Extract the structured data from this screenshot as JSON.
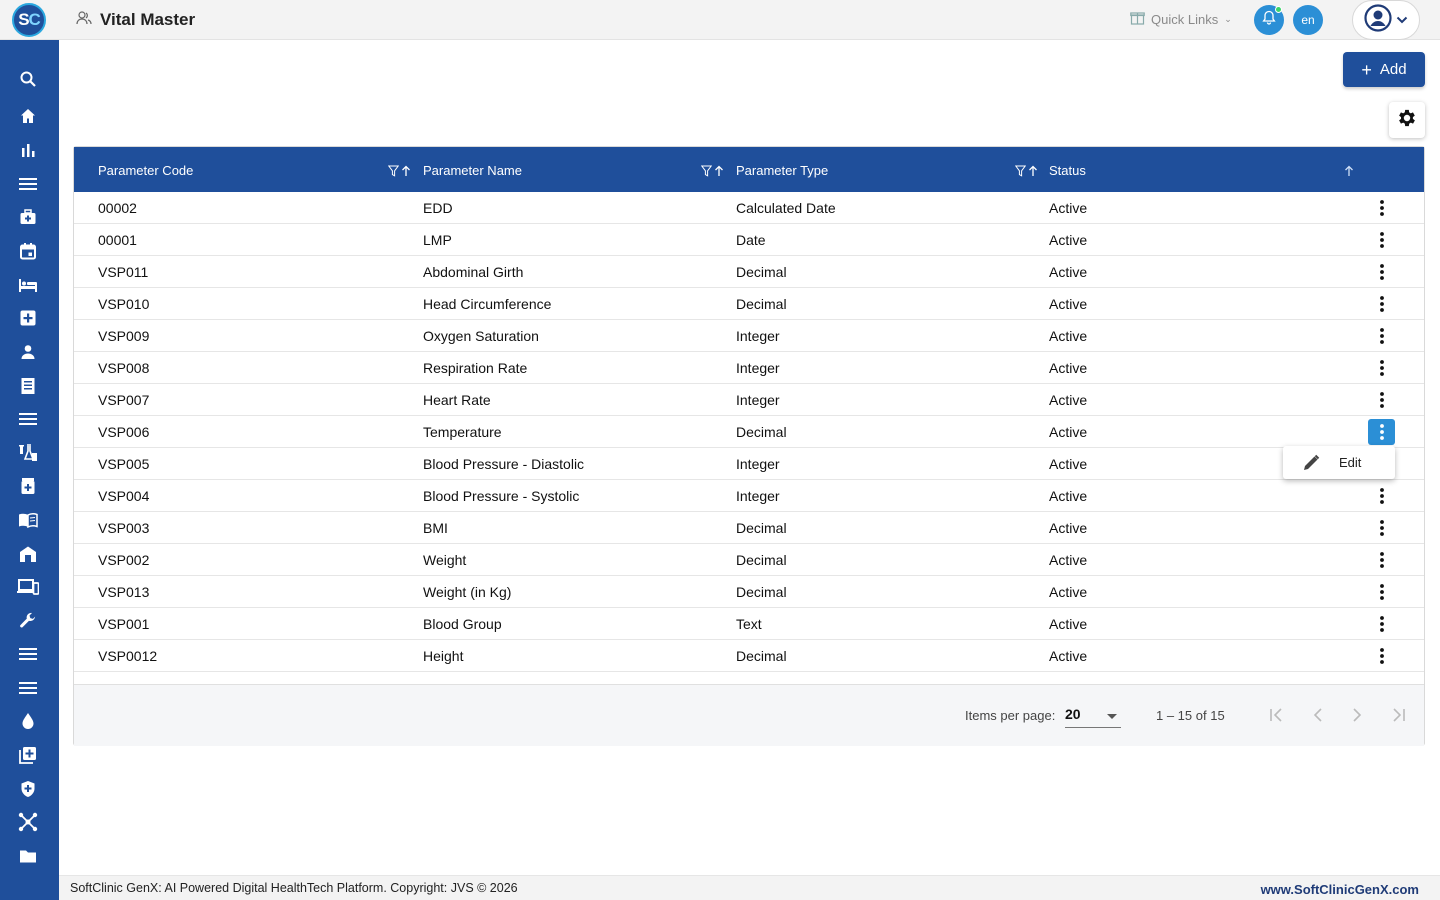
{
  "app": {
    "logo_text_1": "S",
    "logo_text_2": "C",
    "page_title": "Vital Master",
    "quick_links_label": "Quick Links",
    "language": "en"
  },
  "sidebar": {
    "items": [
      {
        "icon": "search-icon"
      },
      {
        "icon": "home-icon"
      },
      {
        "icon": "bar-chart-icon"
      },
      {
        "icon": "menu-lines-icon"
      },
      {
        "icon": "medical-bag-icon"
      },
      {
        "icon": "calendar-icon"
      },
      {
        "icon": "bed-icon"
      },
      {
        "icon": "hospital-plus-icon"
      },
      {
        "icon": "person-icon"
      },
      {
        "icon": "receipt-icon"
      },
      {
        "icon": "menu-lines-icon"
      },
      {
        "icon": "lab-flask-icon"
      },
      {
        "icon": "pharmacy-icon"
      },
      {
        "icon": "book-icon"
      },
      {
        "icon": "store-icon"
      },
      {
        "icon": "devices-icon"
      },
      {
        "icon": "wrench-icon"
      },
      {
        "icon": "menu-lines-icon"
      },
      {
        "icon": "menu-lines-icon"
      },
      {
        "icon": "blood-drop-icon"
      },
      {
        "icon": "add-box-icon"
      },
      {
        "icon": "shield-icon"
      },
      {
        "icon": "network-icon"
      },
      {
        "icon": "folder-icon"
      }
    ]
  },
  "toolbar": {
    "add_label": "Add"
  },
  "table": {
    "columns": [
      "Parameter Code",
      "Parameter Name",
      "Parameter Type",
      "Status"
    ],
    "rows": [
      {
        "code": "00002",
        "name": "EDD",
        "type": "Calculated Date",
        "status": "Active"
      },
      {
        "code": "00001",
        "name": "LMP",
        "type": "Date",
        "status": "Active"
      },
      {
        "code": "VSP011",
        "name": "Abdominal Girth",
        "type": "Decimal",
        "status": "Active"
      },
      {
        "code": "VSP010",
        "name": "Head Circumference",
        "type": "Decimal",
        "status": "Active"
      },
      {
        "code": "VSP009",
        "name": "Oxygen Saturation",
        "type": "Integer",
        "status": "Active"
      },
      {
        "code": "VSP008",
        "name": "Respiration Rate",
        "type": "Integer",
        "status": "Active"
      },
      {
        "code": "VSP007",
        "name": "Heart Rate",
        "type": "Integer",
        "status": "Active"
      },
      {
        "code": "VSP006",
        "name": "Temperature",
        "type": "Decimal",
        "status": "Active"
      },
      {
        "code": "VSP005",
        "name": "Blood Pressure - Diastolic",
        "type": "Integer",
        "status": "Active"
      },
      {
        "code": "VSP004",
        "name": "Blood Pressure - Systolic",
        "type": "Integer",
        "status": "Active"
      },
      {
        "code": "VSP003",
        "name": "BMI",
        "type": "Decimal",
        "status": "Active"
      },
      {
        "code": "VSP002",
        "name": "Weight",
        "type": "Decimal",
        "status": "Active"
      },
      {
        "code": "VSP013",
        "name": "Weight (in Kg)",
        "type": "Decimal",
        "status": "Active"
      },
      {
        "code": "VSP001",
        "name": "Blood Group",
        "type": "Text",
        "status": "Active"
      },
      {
        "code": "VSP0012",
        "name": "Height",
        "type": "Decimal",
        "status": "Active"
      }
    ],
    "active_row": "VSP006"
  },
  "row_menu": {
    "edit_label": "Edit"
  },
  "paginator": {
    "items_per_page_label": "Items per page:",
    "items_per_page": "20",
    "range_label": "1 – 15 of 15"
  },
  "footer": {
    "copyright": "SoftClinic GenX: AI Powered Digital HealthTech Platform. Copyright: JVS © 2026",
    "website": "www.SoftClinicGenX.com"
  },
  "colors": {
    "primary": "#1f4f9b",
    "accent": "#2b8fd6",
    "online": "#3ad36a"
  }
}
